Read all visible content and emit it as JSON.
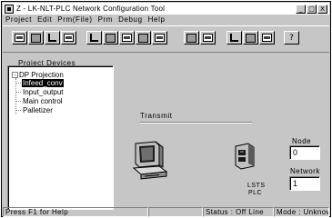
{
  "window": {
    "title": "Z - LK-NLT-PLC Network Configuration Tool",
    "controls": {
      "minimize": "_",
      "maximize": "□",
      "close": "X"
    }
  },
  "menu": [
    "Project",
    "Edit",
    "Prm(File)",
    "Prm",
    "Debug",
    "Help"
  ],
  "toolbar": {
    "buttons": [
      "open-icon",
      "print-icon",
      "node-icon",
      "list-icon",
      "info-icon",
      "io-icon",
      "map-icon",
      "table-icon",
      "chart-icon",
      "plc-icon",
      "menu-icon",
      "upload-icon",
      "config-icon",
      "check-icon",
      "help-icon"
    ],
    "help_glyph": "?"
  },
  "tree": {
    "label": "Project Devices",
    "root": "DP Projection",
    "items": [
      "Infeed_conv",
      "Input_output",
      "Main control",
      "Palletizer"
    ],
    "selected_index": 0
  },
  "transmit": {
    "label": "Transmit"
  },
  "device": {
    "label_line1": "LSTS",
    "label_line2": "PLC"
  },
  "node": {
    "label": "Node",
    "value": "0"
  },
  "network": {
    "label": "Network",
    "value": "1"
  },
  "status": {
    "help": "Press F1 for Help",
    "status": "Status : Off Line",
    "mode": "Mode : Unknown"
  }
}
